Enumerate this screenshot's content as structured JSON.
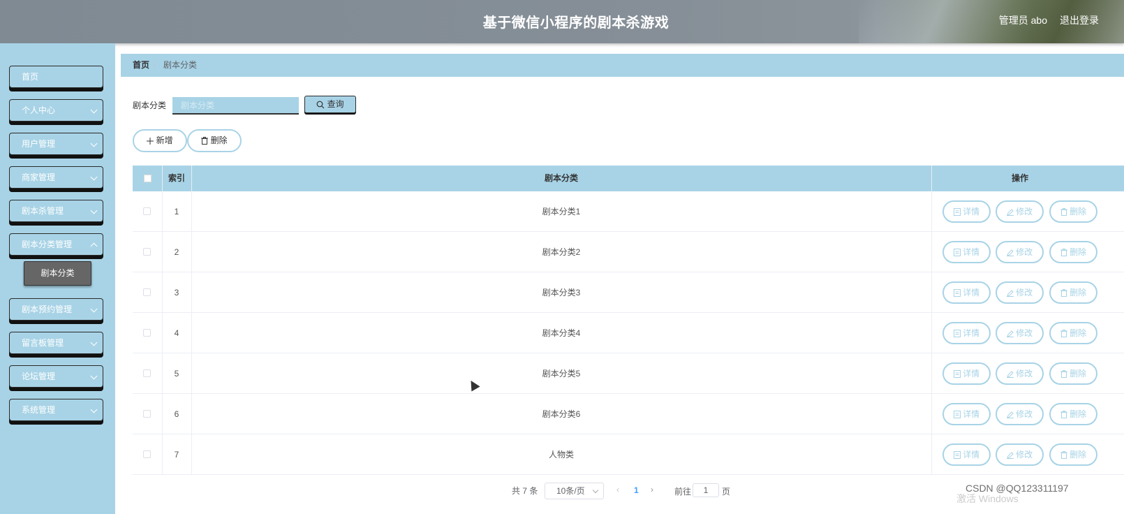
{
  "header": {
    "title": "基于微信小程序的剧本杀游戏",
    "admin_label": "管理员 abo",
    "logout_label": "退出登录"
  },
  "sidebar": {
    "items": [
      {
        "label": "首页",
        "has_children": false
      },
      {
        "label": "个人中心",
        "has_children": true
      },
      {
        "label": "用户管理",
        "has_children": true
      },
      {
        "label": "商家管理",
        "has_children": true
      },
      {
        "label": "剧本杀管理",
        "has_children": true
      },
      {
        "label": "剧本分类管理",
        "has_children": true
      },
      {
        "label": "剧本预约管理",
        "has_children": true
      },
      {
        "label": "留言板管理",
        "has_children": true
      },
      {
        "label": "论坛管理",
        "has_children": true
      },
      {
        "label": "系统管理",
        "has_children": true
      }
    ],
    "active_sub": "剧本分类"
  },
  "breadcrumb": {
    "home": "首页",
    "sep": "/",
    "current": "剧本分类"
  },
  "search": {
    "label": "剧本分类",
    "placeholder": "剧本分类",
    "button": "查询"
  },
  "actions": {
    "add": "新增",
    "delete": "删除"
  },
  "table": {
    "headers": {
      "index": "索引",
      "category": "剧本分类",
      "ops": "操作"
    },
    "rows": [
      {
        "index": "1",
        "category": "剧本分类1"
      },
      {
        "index": "2",
        "category": "剧本分类2"
      },
      {
        "index": "3",
        "category": "剧本分类3"
      },
      {
        "index": "4",
        "category": "剧本分类4"
      },
      {
        "index": "5",
        "category": "剧本分类5"
      },
      {
        "index": "6",
        "category": "剧本分类6"
      },
      {
        "index": "7",
        "category": "人物类"
      }
    ],
    "op_labels": {
      "detail": "详情",
      "edit": "修改",
      "delete": "删除"
    }
  },
  "pagination": {
    "total": "共 7 条",
    "page_size": "10条/页",
    "current_page": "1",
    "goto_label": "前往",
    "goto_value": "1",
    "page_suffix": "页"
  },
  "watermark": {
    "text": "CSDN @QQ123311197",
    "activate": "激活 Windows"
  },
  "colors": {
    "accent": "#a8d3e6",
    "header": "#868f97",
    "active_sub": "#666666"
  }
}
